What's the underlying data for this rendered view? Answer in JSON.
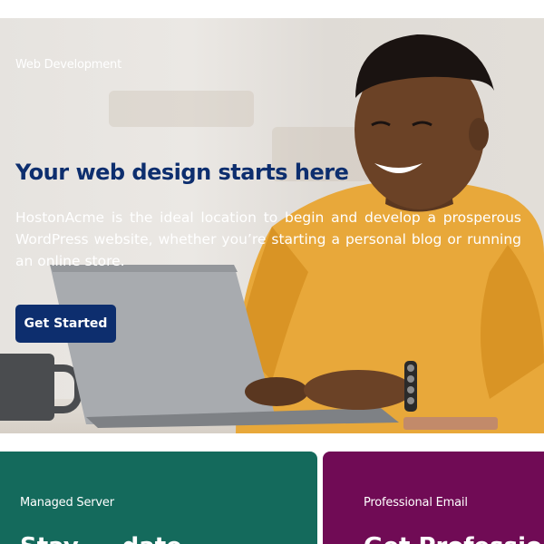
{
  "hero": {
    "eyebrow": "Web Development",
    "title": "Your web design starts here",
    "description": "HostonAcme is the ideal location to begin and develop a prosperous WordPress website, whether you’re starting a personal blog or running an online store.",
    "cta_label": "Get Started",
    "image": "person-with-laptop-photo"
  },
  "cards": [
    {
      "eyebrow": "Managed Server",
      "title": "Stay ... date",
      "color": "#146a5c"
    },
    {
      "eyebrow": "Professional Email",
      "title": "Get Professional I",
      "color": "#700b55"
    }
  ],
  "colors": {
    "brand_navy": "#0d2e6e",
    "sweater": "#e8a83a"
  }
}
